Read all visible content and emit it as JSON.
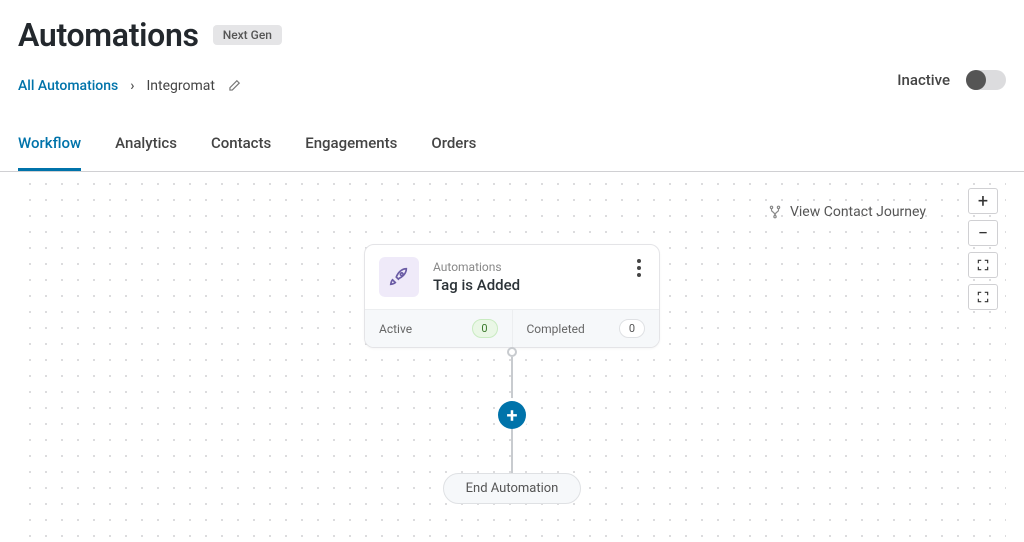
{
  "header": {
    "title": "Automations",
    "badge": "Next Gen"
  },
  "breadcrumb": {
    "root": "All Automations",
    "current": "Integromat"
  },
  "status": {
    "label": "Inactive",
    "enabled": false
  },
  "tabs": [
    {
      "label": "Workflow",
      "active": true
    },
    {
      "label": "Analytics",
      "active": false
    },
    {
      "label": "Contacts",
      "active": false
    },
    {
      "label": "Engagements",
      "active": false
    },
    {
      "label": "Orders",
      "active": false
    }
  ],
  "journey_link": "View Contact Journey",
  "node": {
    "category": "Automations",
    "title": "Tag is Added",
    "stats": {
      "active_label": "Active",
      "active_count": "0",
      "completed_label": "Completed",
      "completed_count": "0"
    }
  },
  "end_label": "End Automation"
}
